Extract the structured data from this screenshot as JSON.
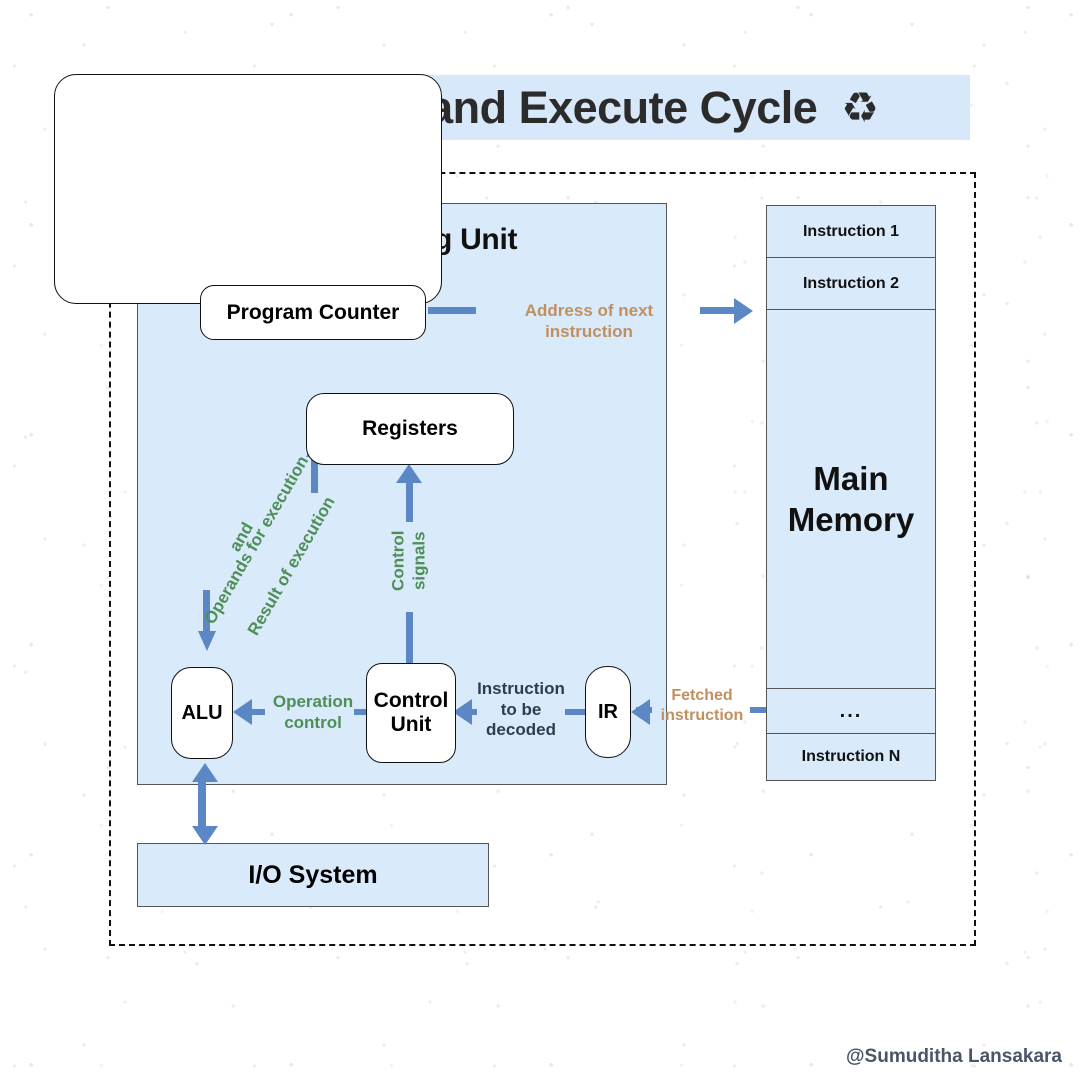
{
  "title": {
    "text": "Fetch, Decode and Execute Cycle",
    "icon": "recycle-icon",
    "icon_glyph": "♻",
    "banner_color": "#D6E8FA"
  },
  "cpu": {
    "label": "Central Processing Unit",
    "fill": "#D9EAFB",
    "nodes": {
      "program_counter": "Program Counter",
      "registers": "Registers",
      "alu": "ALU",
      "control_unit_line1": "Control",
      "control_unit_line2": "Unit",
      "ir": "IR"
    }
  },
  "io_system": {
    "label": "I/O System",
    "fill": "#D9EAFB"
  },
  "memory": {
    "cells": [
      {
        "label": "Instruction 1"
      },
      {
        "label": "Instruction 2"
      },
      {
        "label": "Main Memory",
        "line1": "Main",
        "line2": "Memory"
      },
      {
        "label": "..."
      },
      {
        "label": "Instruction N"
      }
    ],
    "fill": "#D9EAFB"
  },
  "arrow_labels": {
    "address_of_next_instruction": "Address of next instruction",
    "fetched_instruction_line1": "Fetched",
    "fetched_instruction_line2": "instruction",
    "instruction_to_be_decoded_line1": "Instruction",
    "instruction_to_be_decoded_line2": "to be",
    "instruction_to_be_decoded_line3": "decoded",
    "operation_control_line1": "Operation",
    "operation_control_line2": "control",
    "control_signals_line1": "Control",
    "control_signals_line2": "signals",
    "operands_for_execution": "Operands for execution",
    "and": "and",
    "result_of_execution": "Result of execution"
  },
  "colors": {
    "arrow_blue": "#5B87C4",
    "label_tan": "#C09060",
    "label_green": "#4F8F57",
    "label_dark": "#2d3e50",
    "panel_blue": "#D9EAFB"
  },
  "watermark": "@Sumuditha Lansakara"
}
